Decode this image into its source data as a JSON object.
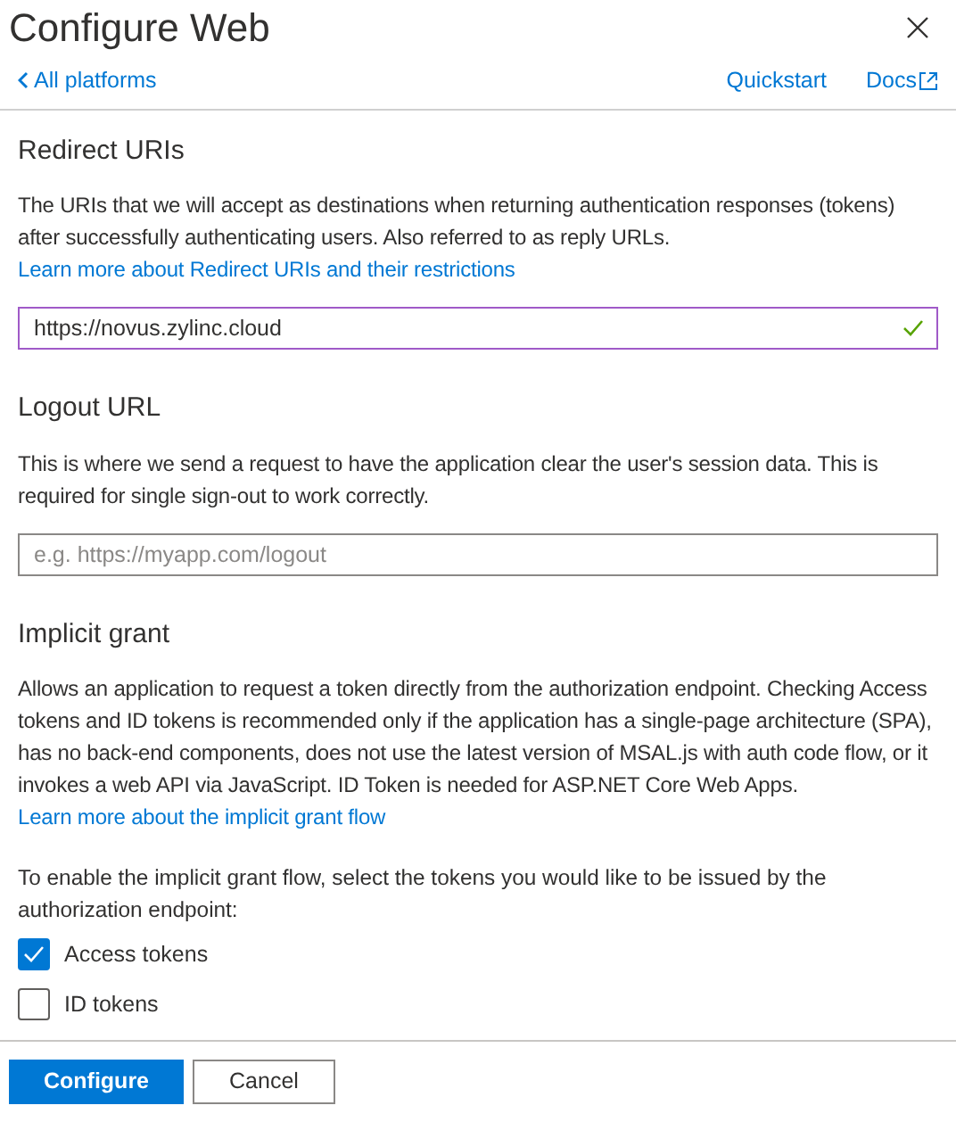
{
  "panel": {
    "title": "Configure Web",
    "back_link": "All platforms",
    "links": [
      "Quickstart",
      "Docs"
    ]
  },
  "sections": [
    {
      "heading": "Redirect URIs",
      "description": "The URIs that we will accept as destinations when returning authentication responses (tokens) after successfully authenticating users. Also referred to as reply URLs.",
      "link": "Learn more about Redirect URIs and their restrictions",
      "field": {
        "value": "https://novus.zylinc.cloud",
        "focused": true,
        "valid": true
      }
    },
    {
      "heading": "Logout URL",
      "description": "This is where we send a request to have the application clear the user's session data. This is required for single sign-out to work correctly.",
      "field": {
        "placeholder": "e.g. https://myapp.com/logout",
        "focused": false,
        "valid": false
      }
    },
    {
      "heading": "Implicit grant",
      "description": "Allows an application to request a token directly from the authorization endpoint. Checking Access tokens and ID tokens is recommended only if the application has a single-page architecture (SPA), has no back-end components, does not use the latest version of MSAL.js with auth code flow, or it invokes a web API via JavaScript. ID Token is needed for ASP.NET Core Web Apps.",
      "link": "Learn more about the implicit grant flow",
      "prompt": "To enable the implicit grant flow, select the tokens you would like to be issued by the authorization endpoint:",
      "options": [
        {
          "label": "Access tokens",
          "checked": true
        },
        {
          "label": "ID tokens",
          "checked": false
        }
      ]
    }
  ],
  "buttons": [
    {
      "label": "Configure",
      "primary": true
    },
    {
      "label": "Cancel",
      "primary": false
    }
  ]
}
